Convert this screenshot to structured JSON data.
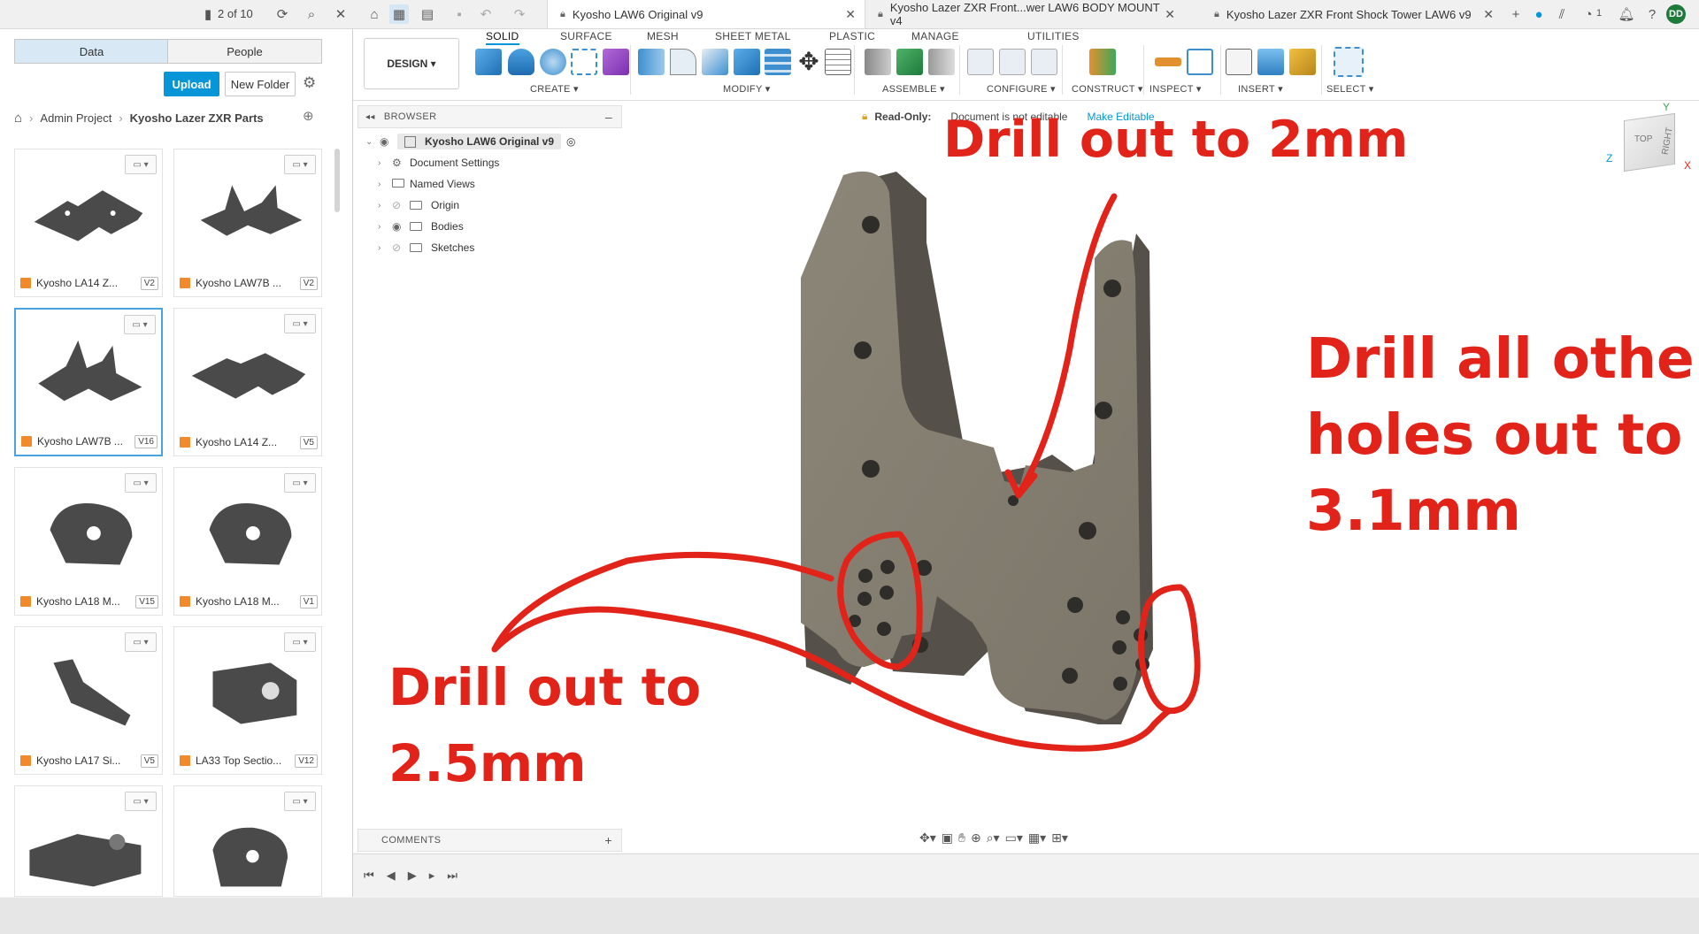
{
  "topbar": {
    "version_counter": "2 of 10",
    "tabs": [
      {
        "label": "Kyosho LAW6 Original v9",
        "active": true
      },
      {
        "label": "Kyosho Lazer ZXR Front...wer LAW6 BODY MOUNT v4",
        "active": false
      },
      {
        "label": "Kyosho Lazer ZXR Front Shock Tower LAW6 v9",
        "active": false
      }
    ],
    "notification_count": "1",
    "user_initials": "DD"
  },
  "datapanel": {
    "tabs": [
      "Data",
      "People"
    ],
    "upload_label": "Upload",
    "new_folder_label": "New Folder",
    "breadcrumb": [
      "Admin Project",
      "Kyosho Lazer ZXR Parts"
    ],
    "items": [
      {
        "label": "Kyosho LA14 Z...",
        "version": "V2"
      },
      {
        "label": "Kyosho LAW7B ...",
        "version": "V2"
      },
      {
        "label": "Kyosho LAW7B ...",
        "version": "V16"
      },
      {
        "label": "Kyosho LA14 Z...",
        "version": "V5"
      },
      {
        "label": "Kyosho LA18 M...",
        "version": "V15"
      },
      {
        "label": "Kyosho LA18 M...",
        "version": "V1"
      },
      {
        "label": "Kyosho LA17 Si...",
        "version": "V5"
      },
      {
        "label": "LA33 Top Sectio...",
        "version": "V12"
      },
      {
        "label": "",
        "version": ""
      },
      {
        "label": "",
        "version": ""
      }
    ]
  },
  "toolbar": {
    "design_label": "DESIGN",
    "workspace_tabs": [
      "SOLID",
      "SURFACE",
      "MESH",
      "SHEET METAL",
      "PLASTIC",
      "MANAGE",
      "UTILITIES"
    ],
    "groups": [
      "CREATE",
      "MODIFY",
      "ASSEMBLE",
      "CONFIGURE",
      "CONSTRUCT",
      "INSPECT",
      "INSERT",
      "SELECT"
    ]
  },
  "browser": {
    "title": "BROWSER",
    "root": "Kyosho LAW6 Original v9",
    "nodes": [
      "Document Settings",
      "Named Views",
      "Origin",
      "Bodies",
      "Sketches"
    ]
  },
  "readonly": {
    "label": "Read-Only:",
    "message": "Document is not editable",
    "action": "Make Editable"
  },
  "viewcube": {
    "top": "TOP",
    "right": "RIGHT",
    "x": "X",
    "y": "Y",
    "z": "Z"
  },
  "annotations": {
    "a1": "Drill out to 2mm",
    "a2_line1": "Drill all other",
    "a2_line2": "holes out to",
    "a2_line3": "3.1mm",
    "a3_line1": "Drill out to",
    "a3_line2": "2.5mm"
  },
  "comments_label": "COMMENTS",
  "colors": {
    "accent": "#0696d7",
    "annotation": "#e2231a",
    "part": "#8a8478"
  }
}
